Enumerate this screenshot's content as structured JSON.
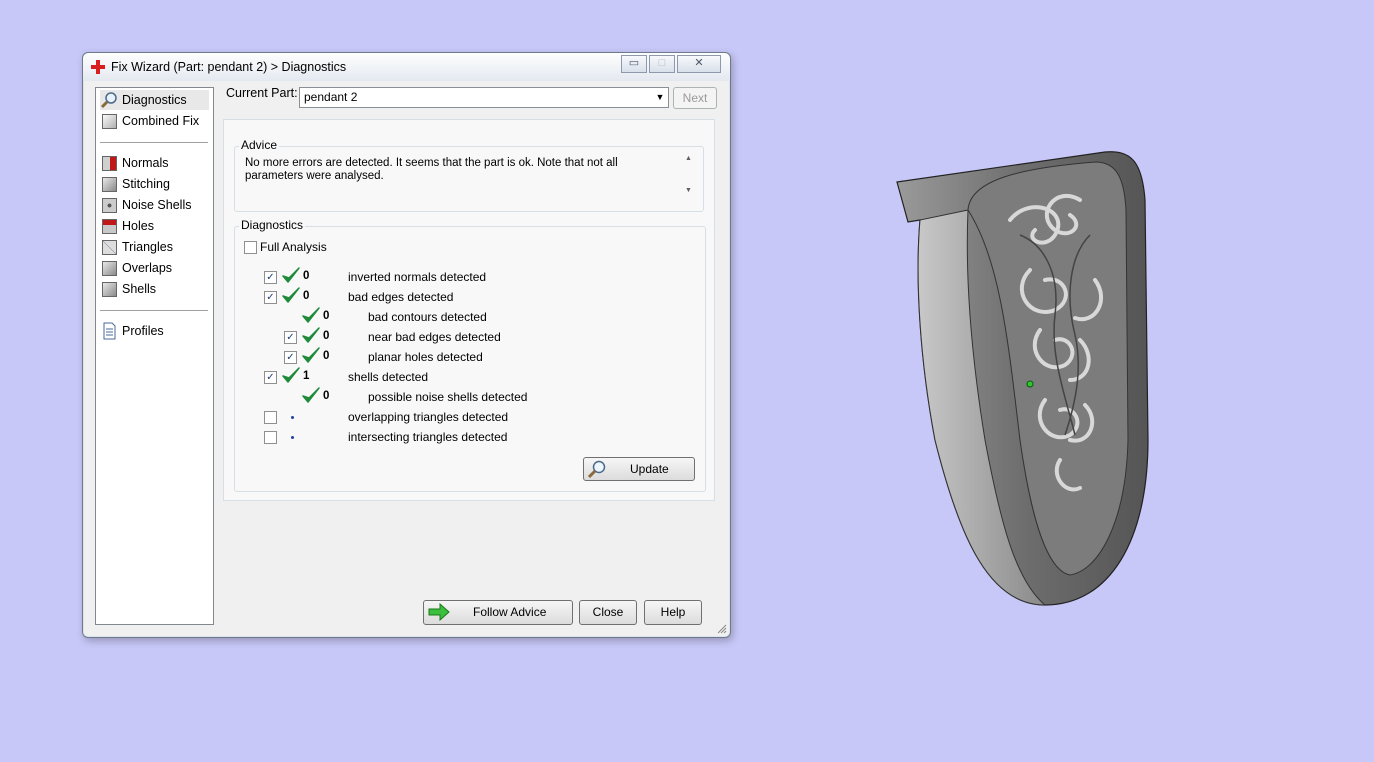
{
  "window": {
    "title": "Fix Wizard (Part: pendant 2) > Diagnostics",
    "controls": {
      "minimize": "▭",
      "maximize": "□",
      "close": "✕"
    }
  },
  "sidebar": {
    "items": [
      {
        "label": "Diagnostics",
        "icon": "magnifier-icon"
      },
      {
        "label": "Combined Fix",
        "icon": "cube-icon"
      },
      {
        "label": "Normals",
        "icon": "cube-icon"
      },
      {
        "label": "Stitching",
        "icon": "cube-icon"
      },
      {
        "label": "Noise Shells",
        "icon": "cube-icon"
      },
      {
        "label": "Holes",
        "icon": "cube-icon"
      },
      {
        "label": "Triangles",
        "icon": "cube-icon"
      },
      {
        "label": "Overlaps",
        "icon": "cube-icon"
      },
      {
        "label": "Shells",
        "icon": "cube-icon"
      },
      {
        "label": "Profiles",
        "icon": "document-icon"
      }
    ]
  },
  "part": {
    "label": "Current Part:",
    "value": "pendant 2",
    "next_label": "Next"
  },
  "advice": {
    "title": "Advice",
    "text": "No more errors are detected. It seems that the part is ok. Note that not all parameters were analysed."
  },
  "diagnostics": {
    "title": "Diagnostics",
    "full_analysis_label": "Full Analysis",
    "rows": [
      {
        "checkbox": true,
        "checked": true,
        "status": "ok",
        "value": "0",
        "label": "inverted normals detected",
        "indent": 0
      },
      {
        "checkbox": true,
        "checked": true,
        "status": "ok",
        "value": "0",
        "label": "bad edges detected",
        "indent": 0
      },
      {
        "checkbox": false,
        "checked": false,
        "status": "ok",
        "value": "0",
        "label": "bad contours detected",
        "indent": 1
      },
      {
        "checkbox": true,
        "checked": true,
        "status": "ok",
        "value": "0",
        "label": "near bad edges detected",
        "indent": 1
      },
      {
        "checkbox": true,
        "checked": true,
        "status": "ok",
        "value": "0",
        "label": "planar holes detected",
        "indent": 1
      },
      {
        "checkbox": true,
        "checked": true,
        "status": "ok",
        "value": "1",
        "label": "shells detected",
        "indent": 0
      },
      {
        "checkbox": false,
        "checked": false,
        "status": "ok",
        "value": "0",
        "label": "possible noise shells detected",
        "indent": 1
      },
      {
        "checkbox": true,
        "checked": false,
        "status": "pending",
        "value": "",
        "label": "overlapping triangles detected",
        "indent": 0
      },
      {
        "checkbox": true,
        "checked": false,
        "status": "pending",
        "value": "",
        "label": "intersecting triangles detected",
        "indent": 0
      }
    ],
    "update_label": "Update"
  },
  "footer": {
    "follow_label": "Follow Advice",
    "close_label": "Close",
    "help_label": "Help"
  },
  "colors": {
    "desktop": "#c8c8f8",
    "check": "#1f8a3a",
    "model": "#8a8a8a"
  }
}
